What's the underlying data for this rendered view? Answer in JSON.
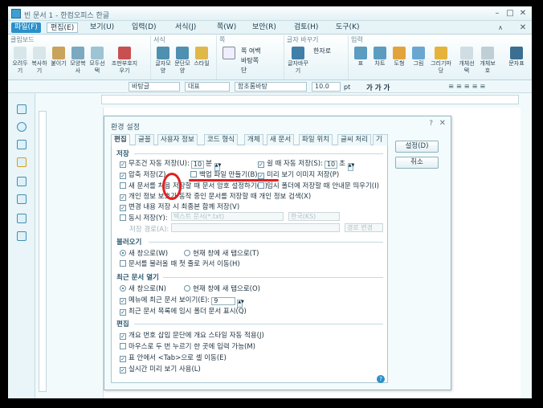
{
  "window": {
    "title": "빈 문서 1 - 한컴오피스 한글"
  },
  "menubar": {
    "items": [
      "파일(F)",
      "편집(E)",
      "보기(U)",
      "입력(D)",
      "서식(J)",
      "쪽(W)",
      "보안(R)",
      "검토(H)",
      "도구(K)"
    ]
  },
  "ribbon": {
    "groups": {
      "clipboard": "클립보드",
      "format": "서식",
      "page": "쪽",
      "charset": "글자 바꾸기",
      "insert": "입력"
    },
    "buttons": {
      "cut": "오려두기",
      "copy": "복사하기",
      "paste": "붙이기",
      "format_copy": "모양복사",
      "select_all": "모두선택",
      "find": "조판부호지우기",
      "char_shape": "글자모양",
      "para_shape": "문단모양",
      "style": "스타일",
      "border": "쪽 여백",
      "bg": "바탕쪽",
      "pgnum": "단",
      "hanja": "한자로",
      "char_change": "글자바꾸기",
      "table": "표",
      "chart": "차트",
      "shape": "도형",
      "picture": "그림",
      "gallery": "그리기마당",
      "object": "개체선택",
      "object_protect": "개체보호",
      "char": "문자표"
    }
  },
  "toolbar2": {
    "style": "바탕글",
    "lang": "대표",
    "font": "함초롬바탕",
    "size": "10.0",
    "unit": "pt"
  },
  "dialog": {
    "title": "환경 설정",
    "tabs": [
      "편집",
      "글꼴",
      "사용자 정보",
      "코드 형식",
      "개체",
      "새 문서",
      "파일 위치",
      "글씨 처리",
      "기타"
    ],
    "buttons": {
      "ok": "설정(D)",
      "cancel": "취소"
    },
    "sections": {
      "save": {
        "title": "저장",
        "autosave_label": "무조건 자동 저장(U):",
        "autosave_value": "10",
        "autosave_unit": "분",
        "idle_label": "쉴 때 자동 저장(S):",
        "idle_value": "10",
        "idle_unit": "초",
        "compress": "압축 저장(Z)",
        "backup": "백업 파일 만들기(B)",
        "preview": "미리 보기 이미지 저장(P)",
        "newdoc_pwd": "새 문서를 처음 저장할 때 문서 암호 설정하기(G)",
        "temp_folder": "임시 폴더에 저장할 때 안내문 띄우기(I)",
        "personal": "개인 정보 보호가 동작 중인 문서를 저장할 때 개인 정보 검색(X)",
        "final": "변경 내용 저장 시 최종본 함께 저장(V)",
        "sync_label": "동시 저장(Y):",
        "sync_format": "텍스트 문서(*.txt)",
        "sync_enc": "한국(KS)",
        "path_label": "저장 경로(A):",
        "path_btn": "경로 변경"
      },
      "open": {
        "title": "불러오기",
        "new_window": "새 창으로(W)",
        "new_tab": "현재 창에 새 탭으로(T)",
        "cursor_first": "문서를 불러올 때 첫 줄로 커서 이동(H)"
      },
      "recent": {
        "title": "최근 문서 열기",
        "new_window": "새 창으로(N)",
        "new_tab": "현재 창에 새 탭으로(O)",
        "menu_label": "메뉴에 최근 문서 보이기(E):",
        "menu_value": "9",
        "temp_show": "최근 문서 목록에 임시 폴더 문서 표시(Q)"
      },
      "edit": {
        "title": "편집",
        "style_auto": "개요 번호 삽입 문단에 개요 스타일 자동 적용(J)",
        "mouse_double": "마우스로 두 번 누르기 한 곳에 입력 가능(M)",
        "tab_move": "표 안에서 <Tab>으로 셀 이동(E)",
        "live_preview": "실시간 미리 보기 사용(L)"
      }
    }
  },
  "colors": {
    "accent": "#2b8fc9",
    "annotation": "#e02020"
  }
}
